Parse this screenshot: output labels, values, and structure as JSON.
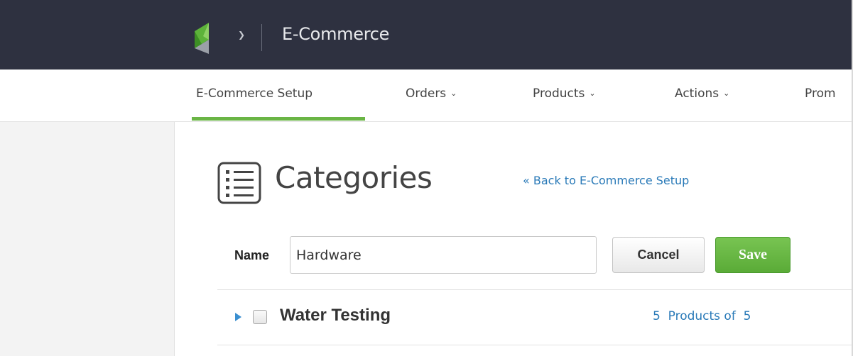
{
  "header": {
    "app_title": "E-Commerce",
    "logo_icon": "app-logo-icon",
    "menu_caret_icon": "chevron-down-icon"
  },
  "nav": {
    "items": [
      {
        "label": "E-Commerce Setup",
        "has_dropdown": false,
        "active": true
      },
      {
        "label": "Orders",
        "has_dropdown": true
      },
      {
        "label": "Products",
        "has_dropdown": true
      },
      {
        "label": "Actions",
        "has_dropdown": true
      },
      {
        "label": "Prom",
        "has_dropdown": false
      }
    ],
    "active_color": "#6ab545"
  },
  "page": {
    "title": "Categories",
    "title_icon": "list-icon",
    "back_link": "« Back to E-Commerce Setup"
  },
  "form": {
    "name_label": "Name",
    "name_value": "Hardware",
    "cancel_label": "Cancel",
    "save_label": "Save"
  },
  "categories": [
    {
      "name": "Water Testing",
      "count_text": "5  Products of  5",
      "checked": false
    }
  ],
  "colors": {
    "header_bg": "#2e3140",
    "link": "#2a7ab8",
    "save_button": "#5aab37"
  }
}
